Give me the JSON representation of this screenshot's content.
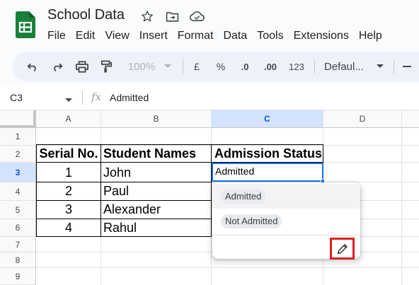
{
  "app": {
    "title": "School Data",
    "brand_color": "#188038",
    "icons": [
      "star-icon",
      "move-to-folder-icon",
      "cloud-status-icon"
    ]
  },
  "menu": [
    "File",
    "Edit",
    "View",
    "Insert",
    "Format",
    "Data",
    "Tools",
    "Extensions",
    "Help"
  ],
  "toolbar": {
    "zoom": "100%",
    "currency": "£",
    "percent": "%",
    "decrease_decimal": ".0",
    "increase_decimal": ".00",
    "number_format": "123",
    "font": "Defaul...",
    "icons": [
      "undo-icon",
      "redo-icon",
      "print-icon",
      "paint-format-icon",
      "chevron-down-icon",
      "minus-icon"
    ]
  },
  "formula_bar": {
    "cell_ref": "C3",
    "fx": "fx",
    "value": "Admitted"
  },
  "sheet": {
    "columns": [
      "A",
      "B",
      "C",
      "D"
    ],
    "rows": [
      "1",
      "2",
      "3",
      "4",
      "5",
      "6",
      "7",
      "8",
      "9"
    ],
    "headers": [
      "Serial No.",
      "Student Names",
      "Admission Status"
    ],
    "data": [
      {
        "serial": "1",
        "name": "John"
      },
      {
        "serial": "2",
        "name": "Paul"
      },
      {
        "serial": "3",
        "name": "Alexander"
      },
      {
        "serial": "4",
        "name": "Rahul"
      }
    ],
    "selected_value": "Admitted",
    "selection_color": "#1a73e8"
  },
  "dropdown": {
    "options": [
      "Admitted",
      "Not Admitted"
    ],
    "edit_highlight_color": "#e02020"
  }
}
